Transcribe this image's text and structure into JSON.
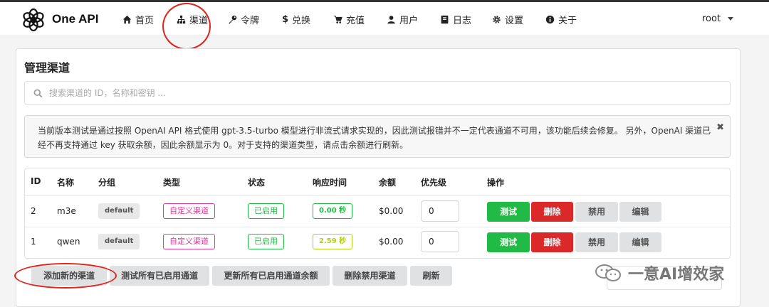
{
  "app": {
    "brand": "One API"
  },
  "nav": {
    "items": [
      {
        "label": "首页",
        "icon": "home-icon"
      },
      {
        "label": "渠道",
        "icon": "sitemap-icon"
      },
      {
        "label": "令牌",
        "icon": "key-icon"
      },
      {
        "label": "兑换",
        "icon": "dollar-icon"
      },
      {
        "label": "充值",
        "icon": "cart-icon"
      },
      {
        "label": "用户",
        "icon": "user-icon"
      },
      {
        "label": "日志",
        "icon": "book-icon"
      },
      {
        "label": "设置",
        "icon": "gear-icon"
      },
      {
        "label": "关于",
        "icon": "info-icon"
      }
    ],
    "user": "root"
  },
  "page": {
    "title": "管理渠道",
    "search_placeholder": "搜索渠道的 ID，名称和密钥 ...",
    "notice": "当前版本测试是通过按照 OpenAI API 格式使用 gpt-3.5-turbo 模型进行非流式请求实现的，因此测试报错并不一定代表通道不可用，该功能后续会修复。 另外，OpenAI 渠道已经不再支持通过 key 获取余额，因此余额显示为 0。对于支持的渠道类型，请点击余额进行刷新。",
    "notice_close": "✖"
  },
  "table": {
    "headers": [
      "ID",
      "名称",
      "分组",
      "类型",
      "状态",
      "响应时间",
      "余额",
      "优先级",
      "操作"
    ],
    "rows": [
      {
        "id": "2",
        "name": "m3e",
        "group": "default",
        "type": "自定义渠道",
        "status": "已启用",
        "response": "0.00 秒",
        "balance": "$0.00",
        "priority": "0"
      },
      {
        "id": "1",
        "name": "qwen",
        "group": "default",
        "type": "自定义渠道",
        "status": "已启用",
        "response": "2.59 秒",
        "balance": "$0.00",
        "priority": "0"
      }
    ],
    "actions": {
      "test": "测试",
      "delete": "删除",
      "disable": "禁用",
      "edit": "编辑"
    }
  },
  "footer": {
    "add": "添加新的渠道",
    "test_all": "测试所有已启用通道",
    "update_balance": "更新所有已启用通道余额",
    "delete_disabled": "删除禁用渠道",
    "refresh": "刷新"
  },
  "watermark": {
    "text": "一意AI增效家"
  },
  "colors": {
    "green": "#21ba45",
    "red": "#db2828",
    "pink": "#e03997",
    "olive": "#b5cc18",
    "annotation": "#e0231c"
  }
}
